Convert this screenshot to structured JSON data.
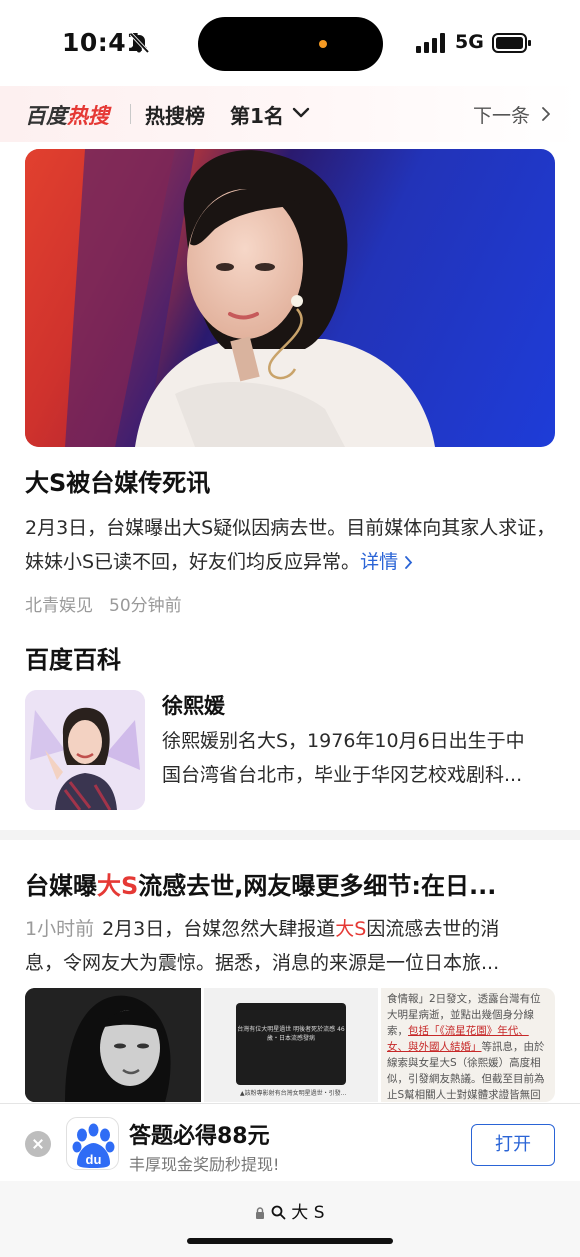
{
  "status_bar": {
    "time": "10:41",
    "network": "5G"
  },
  "hot_header": {
    "logo_part1": "百度",
    "logo_part2": "热搜",
    "board_label": "热搜榜",
    "rank_label": "第1名",
    "next_label": "下一条"
  },
  "news": {
    "title": "大S被台媒传死讯",
    "summary": "2月3日，台媒曝出大S疑似因病去世。目前媒体向其家人求证，妹妹小S已读不回，好友们均反应异常。",
    "detail_link": "详情",
    "source": "北青娱见",
    "time_ago": "50分钟前"
  },
  "baike": {
    "section_title": "百度百科",
    "name": "徐熙媛",
    "desc_line1": "徐熙媛别名大S，1976年10月6日出生于中",
    "desc_line2": "国台湾省台北市，毕业于华冈艺校戏剧科..."
  },
  "article": {
    "title_pre": "台媒曝",
    "title_hl": "大S",
    "title_post": "流感去世,网友曝更多细节:在日...",
    "time_ago": "1小时前",
    "summary_pre": "2月3日，台媒忽然大肆报道",
    "summary_hl": "大S",
    "summary_post": "因流感去世的消",
    "summary_line2": "息，令网友大为震惊。据悉，消息的来源是一位日本旅...",
    "thumb2_text": "台灣有位大明星過世 明後者死於流感 46歲・日本流感發病",
    "thumb2_note": "▲該粉專影射有台灣女明星過世・引發...",
    "thumb3_l1": "食情報」2日發文，透露台灣有位",
    "thumb3_l2": "大明星病逝，並點出幾個身分線",
    "thumb3_l3_pre": "索，",
    "thumb3_l3_u": "包括「《流星花園》年代、",
    "thumb3_l4_u": "女、與外國人結婚」",
    "thumb3_l4_post": "等訊息，由於",
    "thumb3_l5": "線索與女星大S（徐熙媛）高度相",
    "thumb3_l6": "似，引發網友熱議。但截至目前為",
    "thumb3_l7": "止S幫相關人士對媒體求證皆無回"
  },
  "ad": {
    "icon_text": "du",
    "title": "答题必得88元",
    "subtitle": "丰厚现金奖励秒提现!",
    "open_button": "打开"
  },
  "url_bar": {
    "query": "大 S"
  },
  "colors": {
    "accent_blue": "#2a64d6",
    "highlight_red": "#e53935",
    "meta_gray": "#9a9a9a"
  }
}
